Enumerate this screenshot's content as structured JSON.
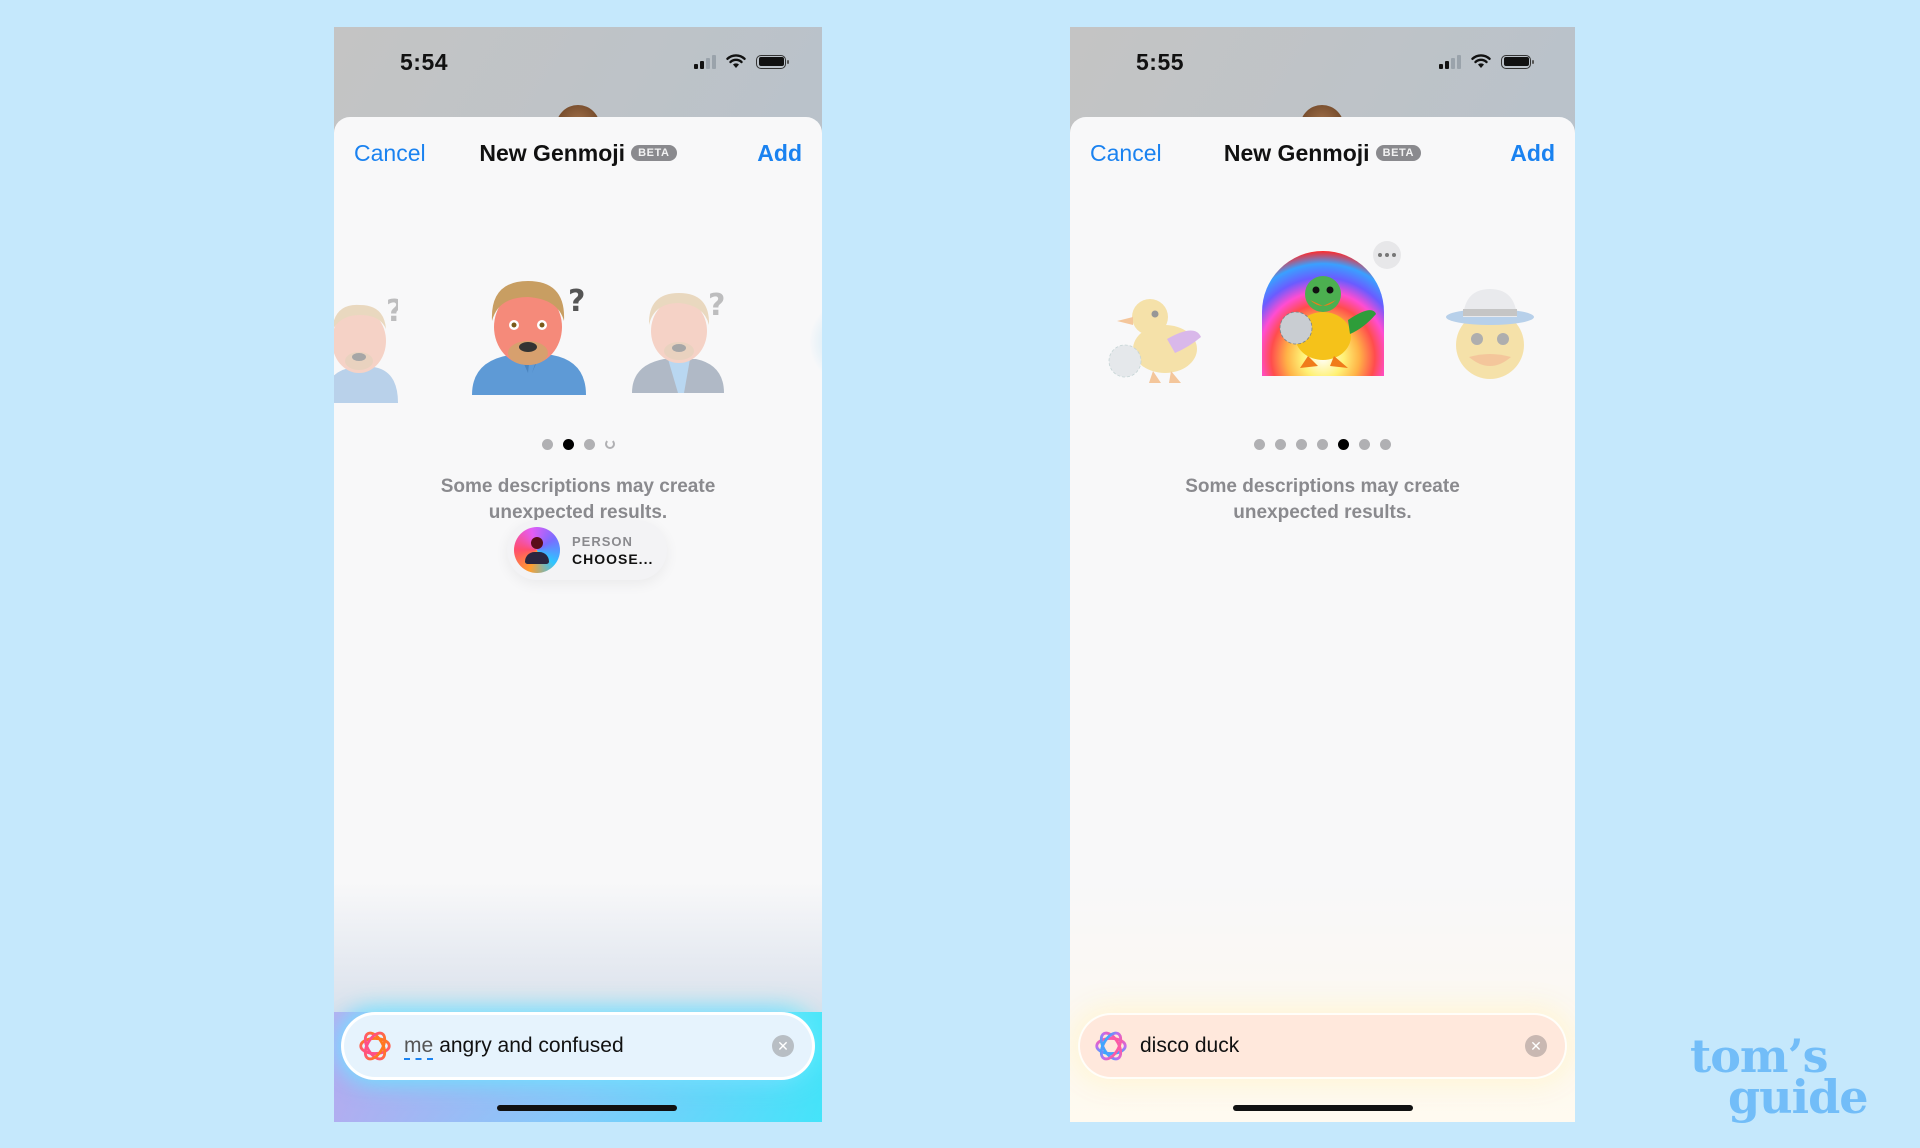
{
  "screens": [
    {
      "id": "left",
      "status_bar": {
        "time": "5:54",
        "signal_bars_filled": 2,
        "signal_bars_total": 4,
        "wifi": "wifi-icon",
        "battery": "battery-full-icon"
      },
      "header": {
        "cancel_label": "Cancel",
        "title": "New Genmoji",
        "badge": "BETA",
        "add_label": "Add"
      },
      "carousel": {
        "items": [
          "memoji-left-confused (dimmed)",
          "memoji-center-angry-confused (selected)",
          "memoji-right-confused (dimmed)",
          "loading-placeholder"
        ],
        "page_count": 4,
        "active_page": 2,
        "last_page_loading": true
      },
      "description": {
        "line1": "Some descriptions may create",
        "line2": "unexpected results."
      },
      "person_picker": {
        "label": "PERSON",
        "value": "CHOOSE..."
      },
      "prompt": {
        "token": "me",
        "text": "angry and confused",
        "icon": "genmoji-sparkle-icon",
        "clear_icon": "clear-icon"
      }
    },
    {
      "id": "right",
      "status_bar": {
        "time": "5:55",
        "signal_bars_filled": 2,
        "signal_bars_total": 4,
        "wifi": "wifi-icon",
        "battery": "battery-full-icon"
      },
      "header": {
        "cancel_label": "Cancel",
        "title": "New Genmoji",
        "badge": "BETA",
        "add_label": "Add"
      },
      "carousel": {
        "items": [
          "duck-with-disco-ball (dimmed)",
          "rainbow-disco-duck (selected)",
          "duck-face-disco-hat (dimmed)"
        ],
        "page_count": 7,
        "active_page": 5
      },
      "description": {
        "line1": "Some descriptions may create",
        "line2": "unexpected results."
      },
      "prompt": {
        "text": "disco duck",
        "icon": "genmoji-sparkle-icon",
        "clear_icon": "clear-icon"
      }
    }
  ],
  "watermark": {
    "line1": "tom’s",
    "line2": "guide"
  },
  "colors": {
    "background": "#c5e8fc",
    "accent": "#1a82f0",
    "watermark": "#72bdf8"
  }
}
